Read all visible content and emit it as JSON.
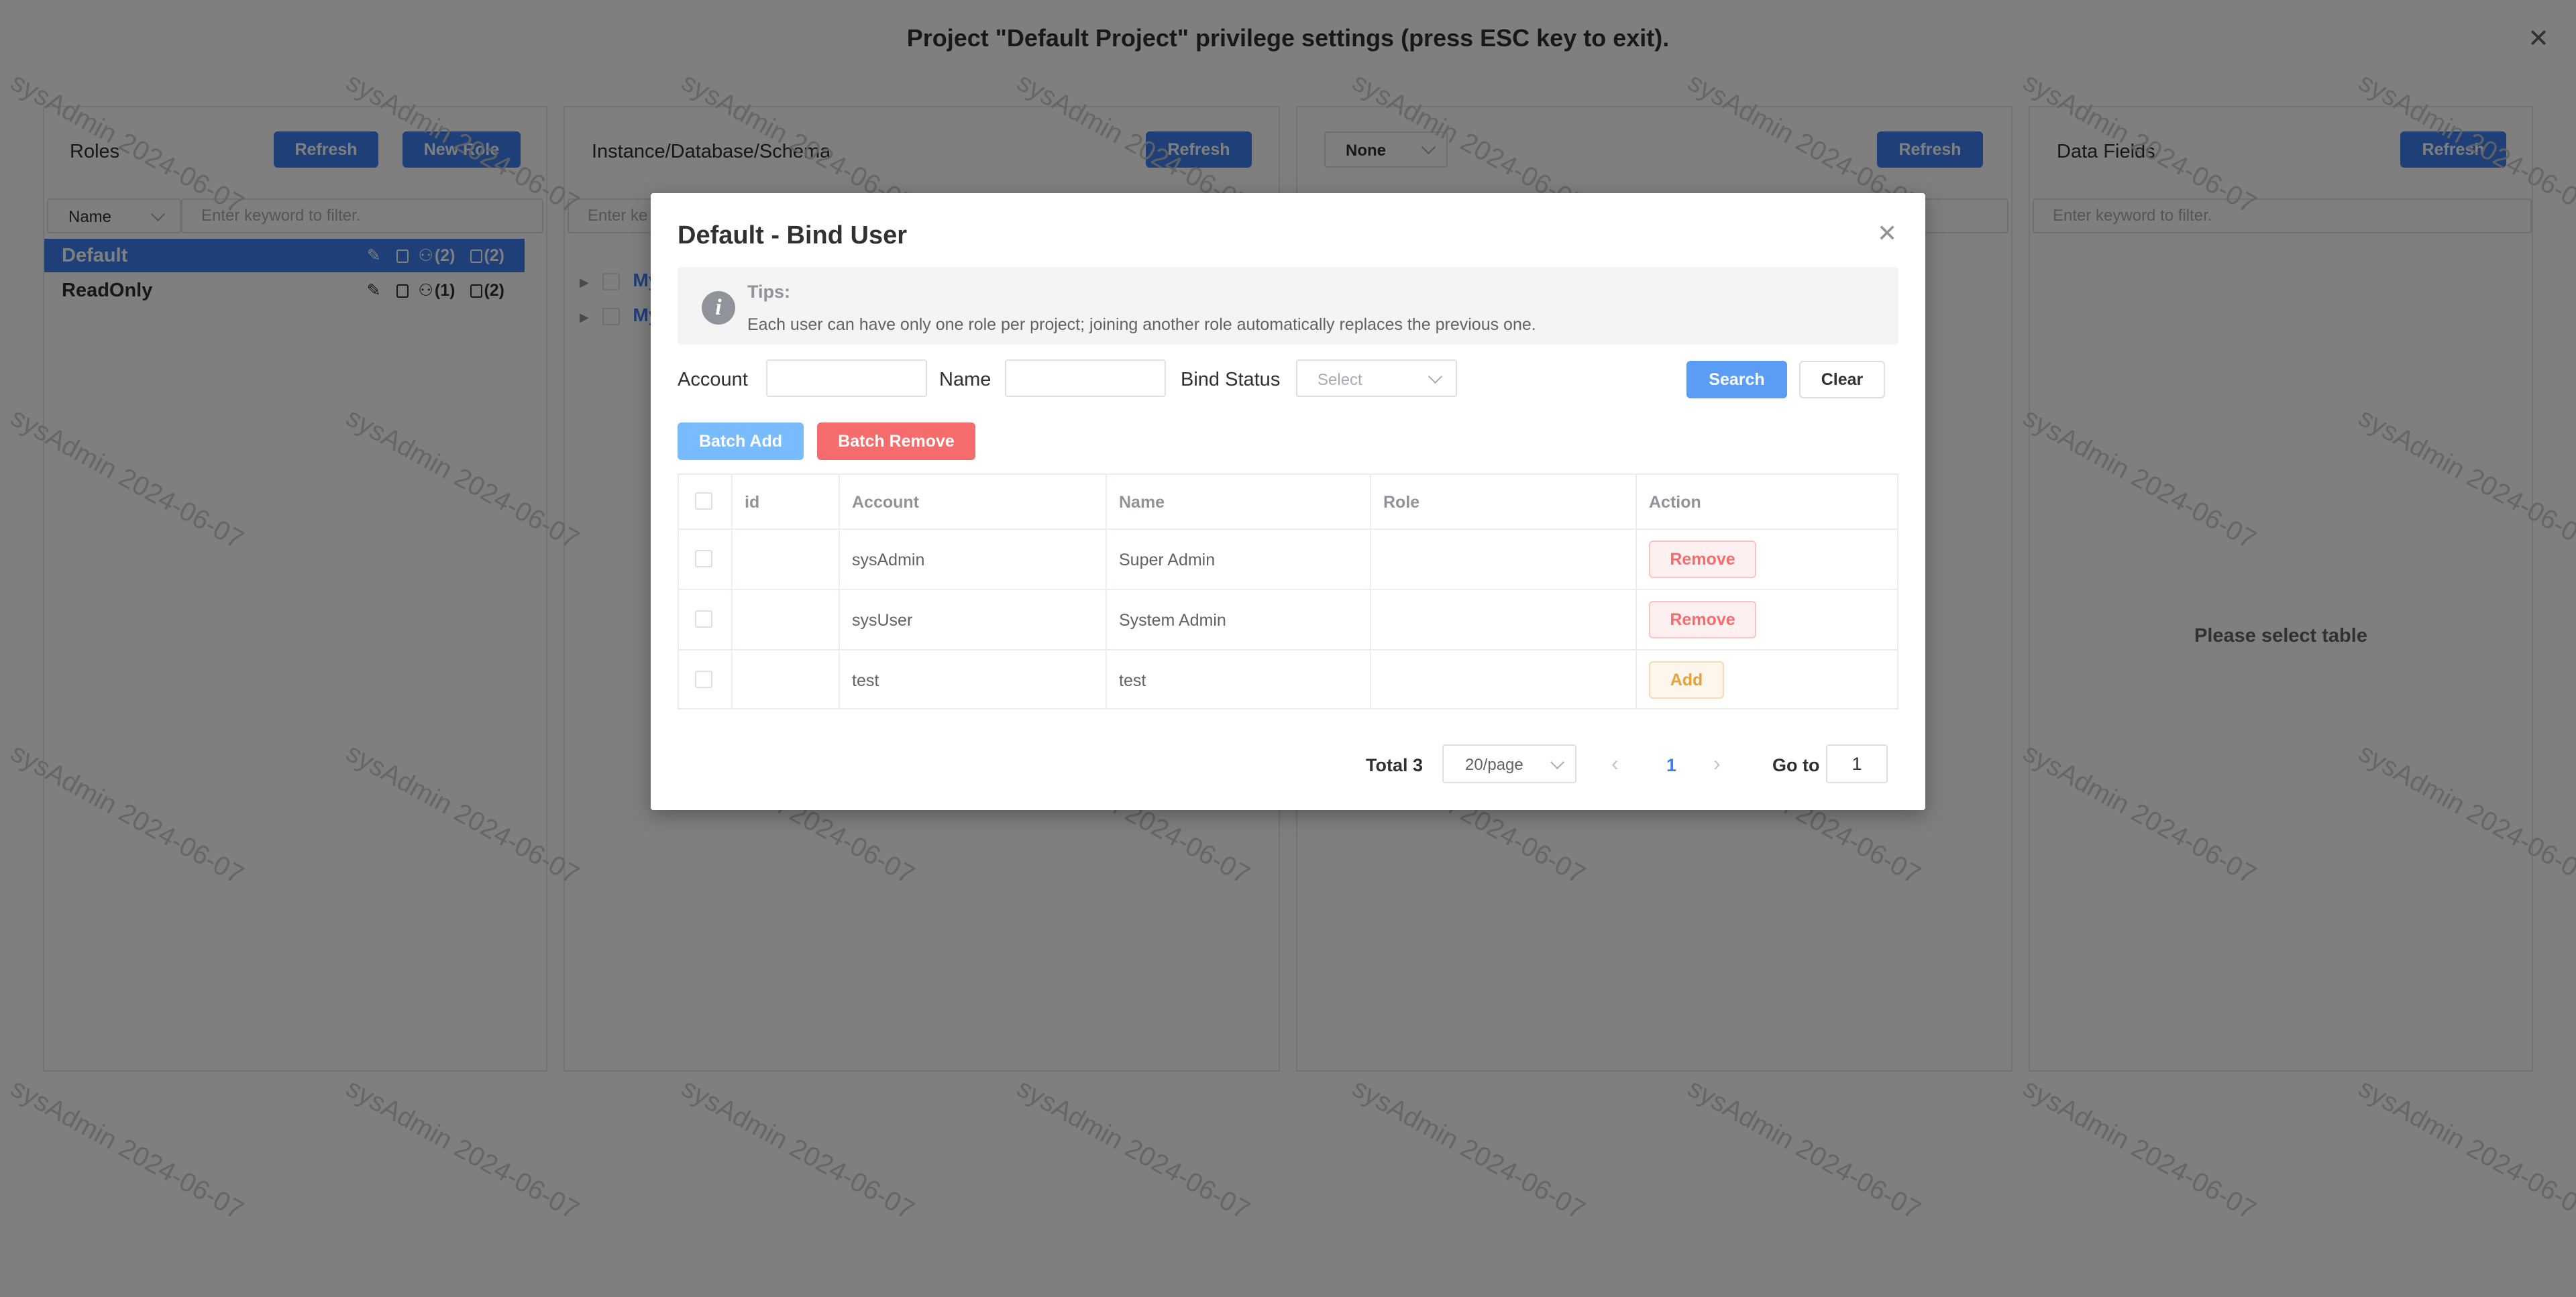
{
  "page": {
    "title": "Project \"Default Project\" privilege settings (press ESC key to exit).",
    "close_icon": "close-icon"
  },
  "roles_panel": {
    "title": "Roles",
    "refresh_label": "Refresh",
    "new_role_label": "New Role",
    "filter_field": "Name",
    "filter_placeholder": "Enter keyword to filter.",
    "roles": [
      {
        "name": "Default",
        "users": "(2)",
        "resources": "(2)",
        "selected": true
      },
      {
        "name": "ReadOnly",
        "users": "(1)",
        "resources": "(2)",
        "selected": false
      }
    ]
  },
  "instance_panel": {
    "title": "Instance/Database/Schema",
    "refresh_label": "Refresh",
    "filter_placeholder": "Enter ke",
    "tree_items": [
      "My",
      "My"
    ]
  },
  "table_panel": {
    "select_value": "None",
    "refresh_label": "Refresh"
  },
  "fields_panel": {
    "title": "Data Fields",
    "refresh_label": "Refresh",
    "filter_placeholder": "Enter keyword to filter.",
    "empty_text": "Please select table"
  },
  "watermark_text": "sysAdmin 2024-06-07",
  "dialog": {
    "title": "Default - Bind User",
    "tips_title": "Tips:",
    "tips_text": "Each user can have only one role per project; joining another role automatically replaces the previous one.",
    "filters": {
      "account_label": "Account",
      "name_label": "Name",
      "bind_status_label": "Bind Status",
      "bind_status_placeholder": "Select",
      "search_label": "Search",
      "clear_label": "Clear"
    },
    "batch_add_label": "Batch Add",
    "batch_remove_label": "Batch Remove",
    "columns": [
      "id",
      "Account",
      "Name",
      "Role",
      "Action"
    ],
    "rows": [
      {
        "id": "",
        "account": "sysAdmin",
        "name": "Super Admin",
        "role": "",
        "action": "Remove"
      },
      {
        "id": "",
        "account": "sysUser",
        "name": "System Admin",
        "role": "",
        "action": "Remove"
      },
      {
        "id": "",
        "account": "test",
        "name": "test",
        "role": "",
        "action": "Add"
      }
    ],
    "pagination": {
      "total_label": "Total 3",
      "page_size": "20/page",
      "current_page": "1",
      "goto_label": "Go to",
      "goto_value": "1"
    }
  }
}
